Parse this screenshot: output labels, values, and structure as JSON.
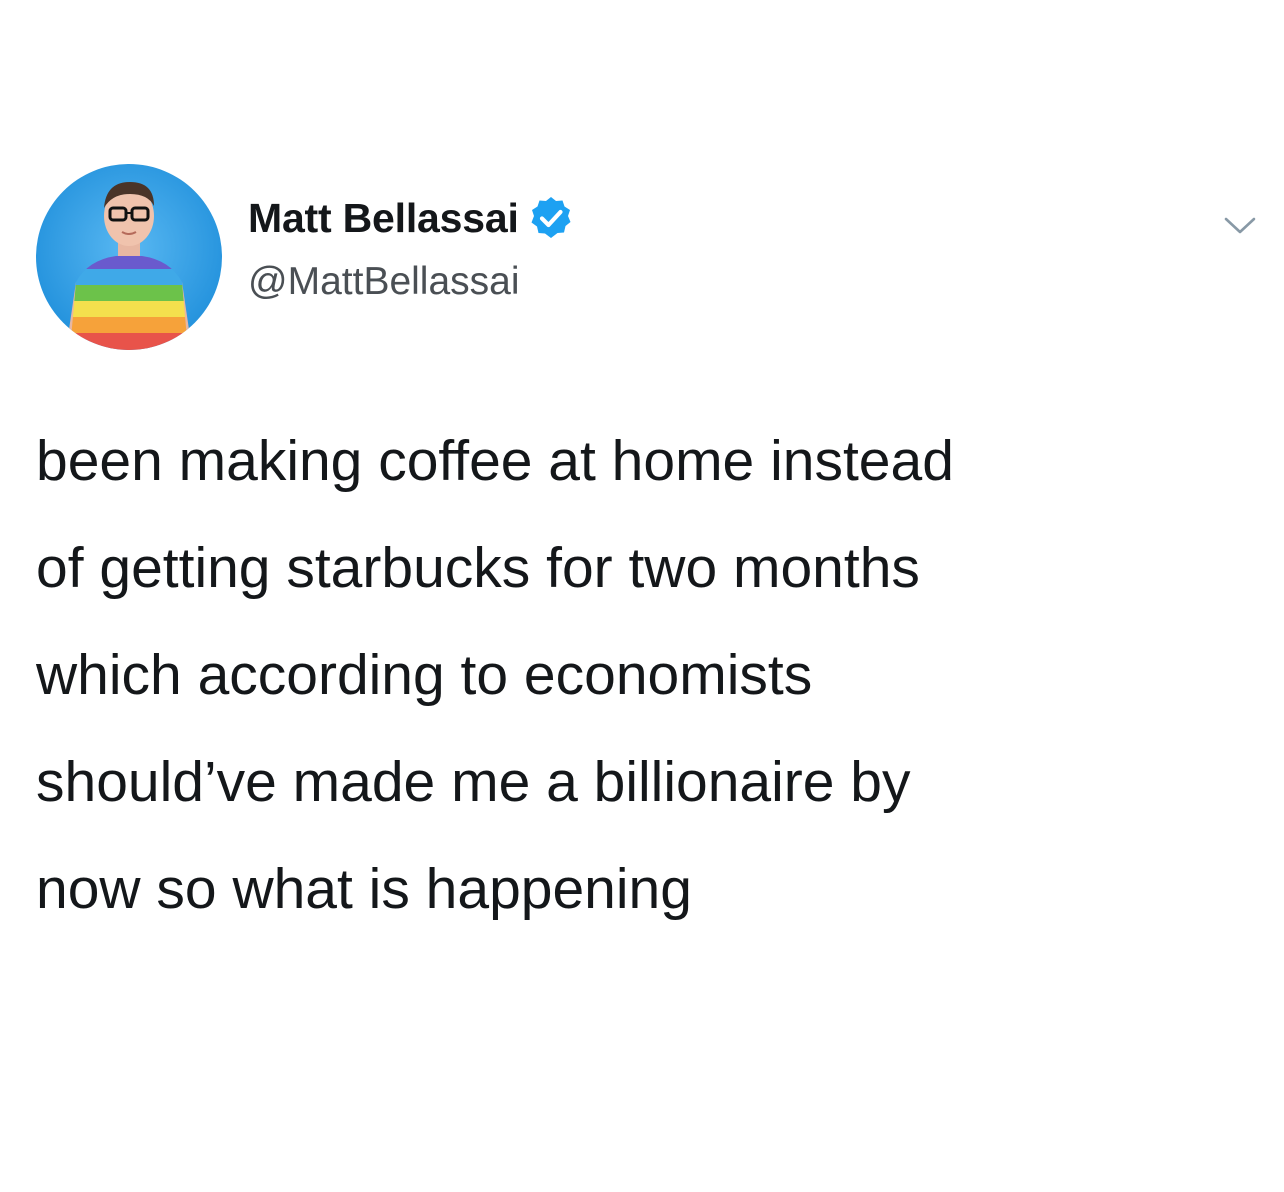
{
  "author": {
    "display_name": "Matt Bellassai",
    "handle": "@MattBellassai",
    "verified": true,
    "avatar_icon": "profile-avatar"
  },
  "menu": {
    "icon": "chevron-down-icon"
  },
  "tweet": {
    "lines": [
      "been making coffee at home instead",
      "of getting starbucks for two months",
      "which according to economists",
      "should’ve made me a billionaire by",
      "now so what is happening"
    ]
  },
  "colors": {
    "verified_badge": "#1da1f2",
    "avatar_background": "#2e9ee6",
    "text": "#14171a",
    "handle": "#4a4f54"
  }
}
